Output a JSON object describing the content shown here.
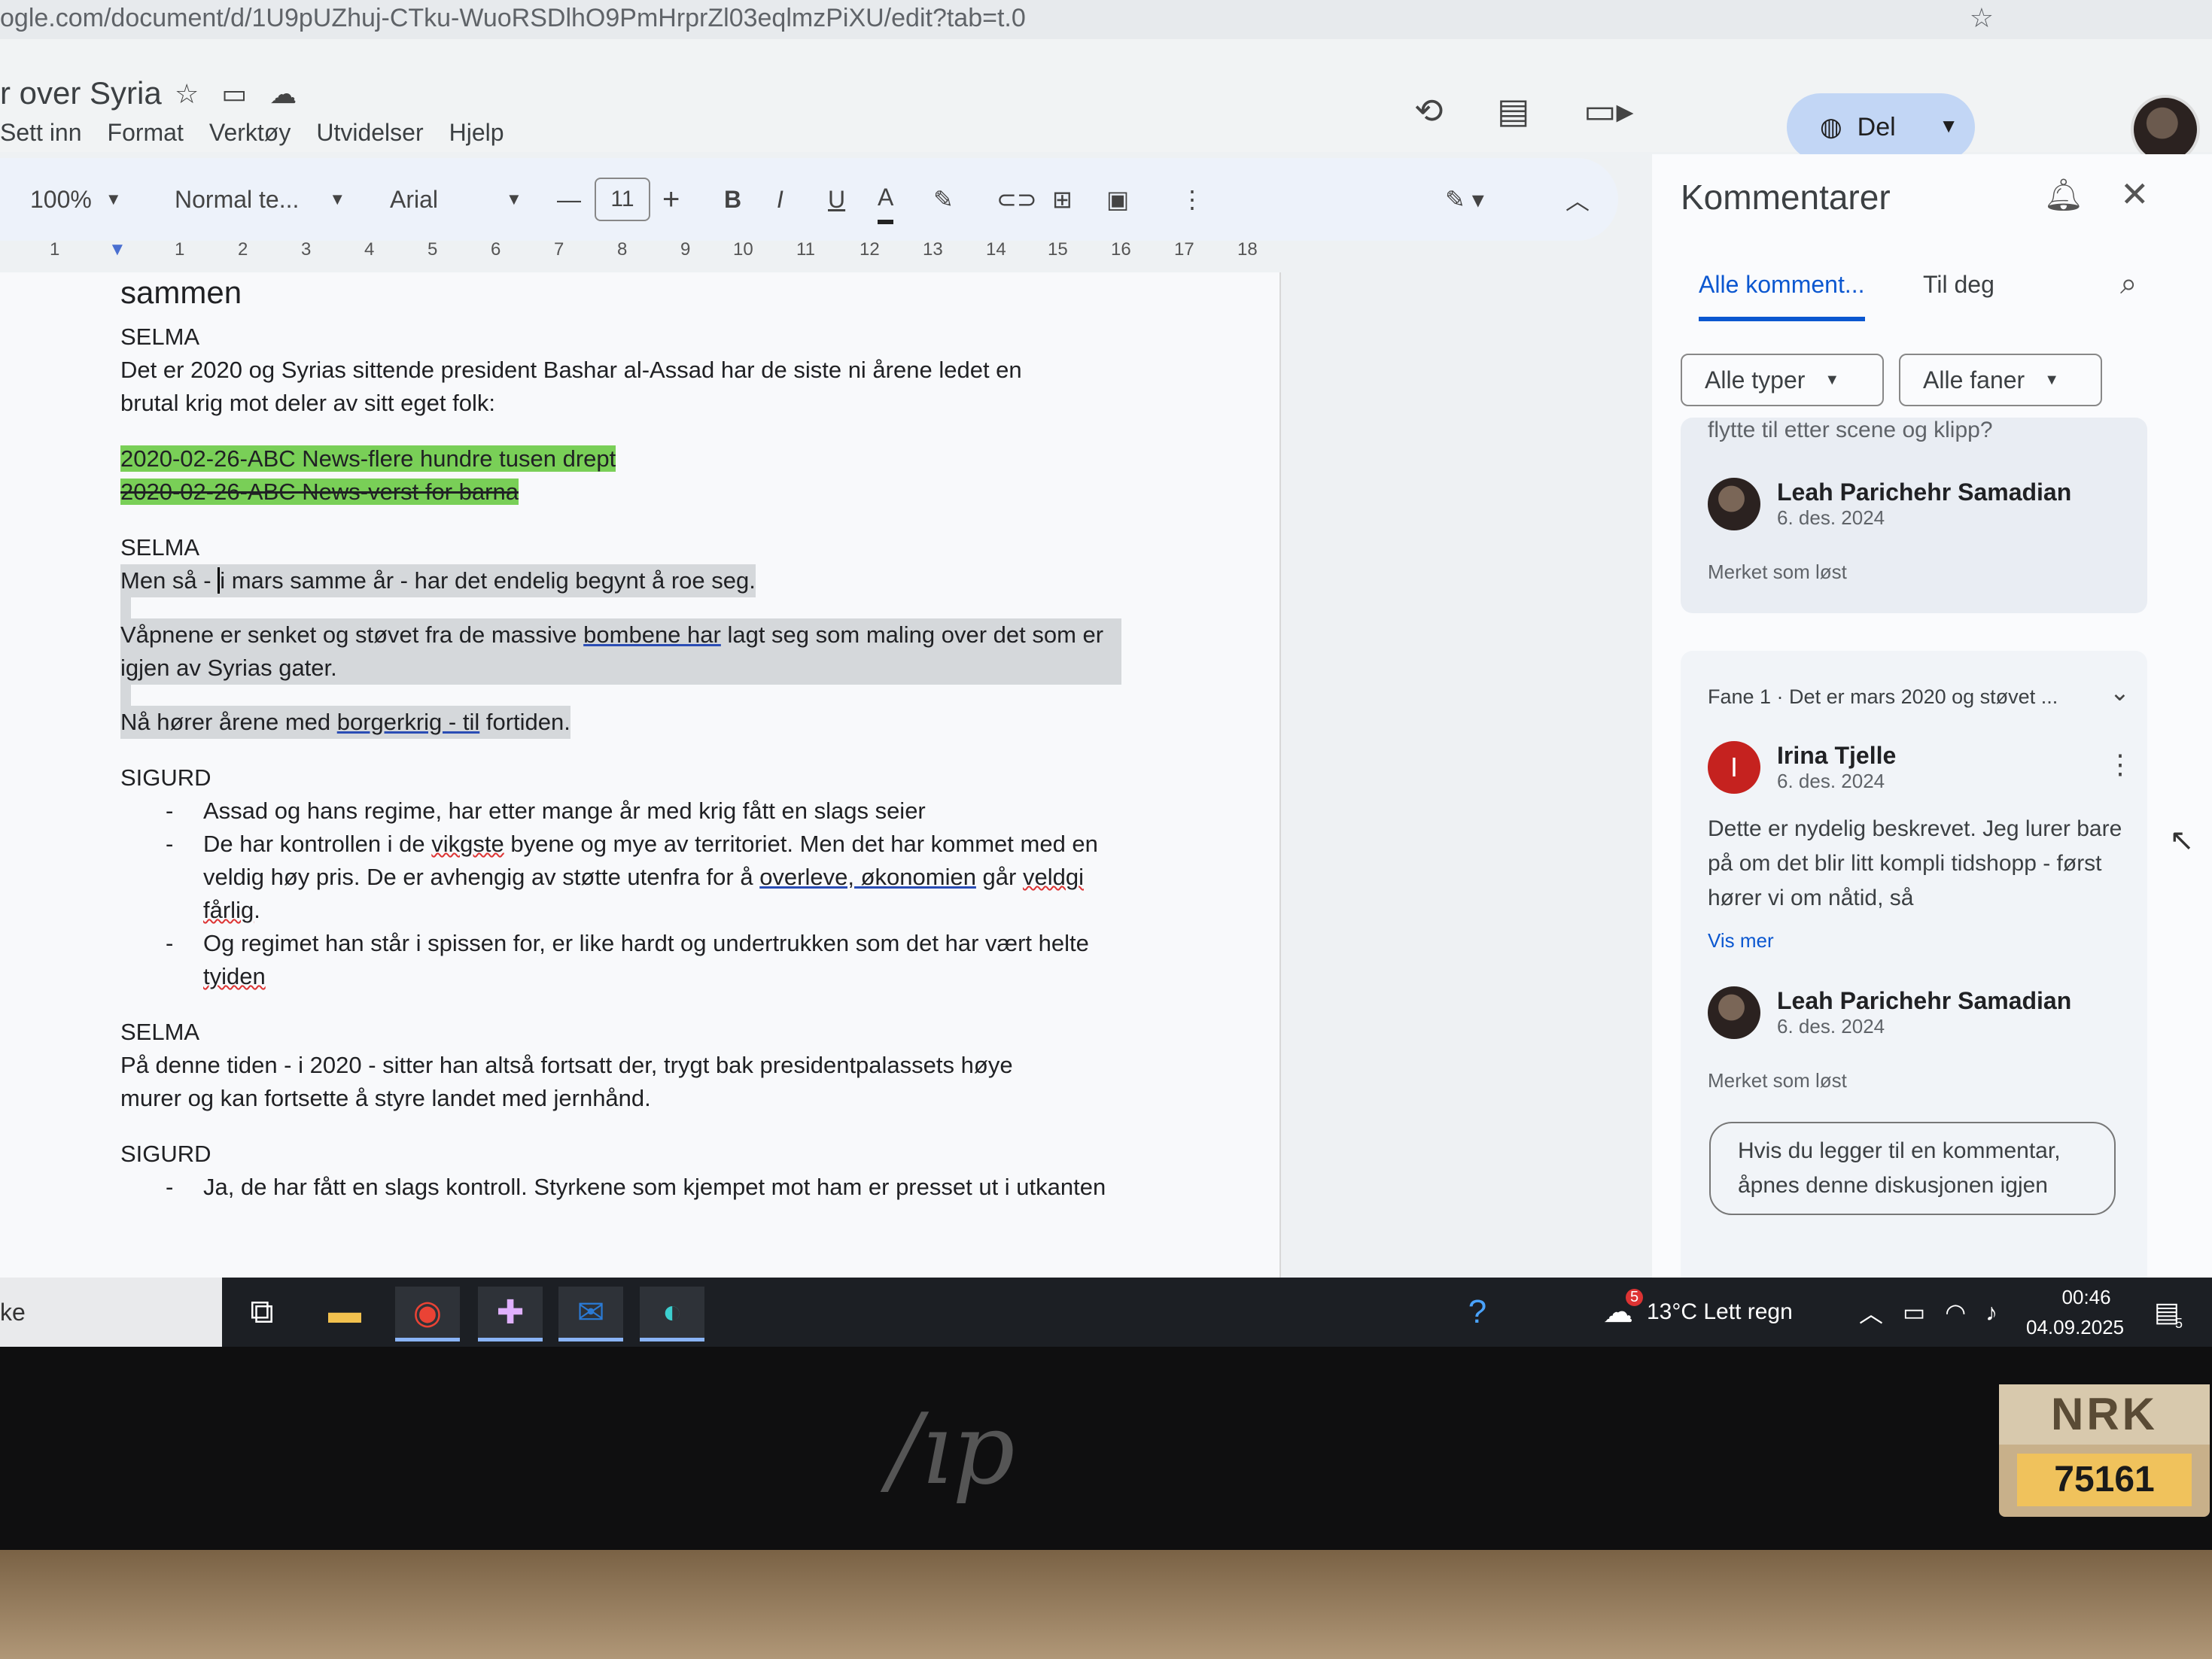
{
  "browser": {
    "url": "ogle.com/document/d/1U9pUZhuj-CTku-WuoRSDlhO9PmHrprZl03eqlmzPiXU/edit?tab=t.0"
  },
  "doc": {
    "title": "r over Syria",
    "menu": [
      "Sett inn",
      "Format",
      "Verktøy",
      "Utvidelser",
      "Hjelp"
    ],
    "share_label": "Del"
  },
  "toolbar": {
    "zoom": "100%",
    "style": "Normal te...",
    "font": "Arial",
    "font_size": "11",
    "bold": "B",
    "italic": "I",
    "underline": "U",
    "text_color": "A"
  },
  "ruler": [
    "1",
    "1",
    "2",
    "3",
    "4",
    "5",
    "6",
    "7",
    "8",
    "9",
    "10",
    "11",
    "12",
    "13",
    "14",
    "15",
    "16",
    "17",
    "18"
  ],
  "content": {
    "heading": "sammen",
    "selma1_speaker": "SELMA",
    "selma1_text": "Det er 2020 og Syrias sittende president Bashar al-Assad har de siste ni årene ledet en brutal krig mot deler av sitt eget folk:",
    "clip1": "2020-02-26-ABC News-flere hundre tusen drept",
    "clip2": "2020-02-26-ABC News-verst for barna",
    "selma2_speaker": "SELMA",
    "selma2_line1_pre": "Men så - ",
    "selma2_line1_cursor": "i",
    "selma2_line1_post": " mars samme år - har det endelig begynt å roe seg.",
    "selma2_line2_a": "Våpnene er senket og støvet fra de massive ",
    "selma2_line2_b": "bombene har",
    "selma2_line2_c": " lagt seg som maling over det som er igjen av Syrias gater.",
    "selma2_line3_a": "Nå hører årene med ",
    "selma2_line3_b": "borgerkrig - til",
    "selma2_line3_c": " fortiden.",
    "sigurd1_speaker": "SIGURD",
    "bullet1": "Assad og hans regime, har etter mange år med krig fått en slags seier",
    "bullet2_a": "De har kontrollen i de ",
    "bullet2_b": "vikgste",
    "bullet2_c": " byene og mye av territoriet. Men det har kommet med en veldig høy pris. De er avhengig av støtte utenfra for å ",
    "bullet2_d": "overleve, økonomien",
    "bullet2_e": " går ",
    "bullet2_f": "veldgi fårlig",
    "bullet2_g": ".",
    "bullet3_a": "Og regimet han står i spissen for, er like hardt og undertrukken som det har vært helte ",
    "bullet3_b": "tyiden",
    "selma3_speaker": "SELMA",
    "selma3_text": "På denne tiden - i 2020 - sitter han altså fortsatt der, trygt bak presidentpalassets høye murer og kan fortsette å styre landet med jernhånd.",
    "sigurd2_speaker": "SIGURD",
    "bullet4": "Ja, de har fått en slags kontroll. Styrkene som kjempet mot ham er presset ut i utkanten",
    "bullet_dash": "-"
  },
  "comments": {
    "title": "Kommentarer",
    "tab_all": "Alle komment...",
    "tab_you": "Til deg",
    "filter_types": "Alle typer",
    "filter_tabs": "Alle faner",
    "card1_snippet": "flytte til etter scene og klipp?",
    "card1_user": "Leah Parichehr Samadian",
    "card1_date": "6. des. 2024",
    "card1_status": "Merket som løst",
    "card2_context": "Fane 1 · Det er mars 2020 og støvet ...",
    "card2_user": "Irina Tjelle",
    "card2_initial": "I",
    "card2_date": "6. des. 2024",
    "card2_body": "Dette er nydelig beskrevet. Jeg lurer bare på om det blir litt kompli tidshopp - først hører vi om nåtid, så",
    "card2_more": "Vis mer",
    "card2_reply_user": "Leah Parichehr Samadian",
    "card2_reply_date": "6. des. 2024",
    "card2_status": "Merket som løst",
    "reply_placeholder": "Hvis du legger til en kommentar, åpnes denne diskusjonen igjen"
  },
  "taskbar": {
    "search_text": "ke",
    "weather": "13°C  Lett regn",
    "weather_badge": "5",
    "time": "00:46",
    "date": "04.09.2025",
    "notif_count": "5"
  },
  "sticker": {
    "brand": "NRK",
    "number": "75161"
  },
  "laptop_logo": "hp"
}
